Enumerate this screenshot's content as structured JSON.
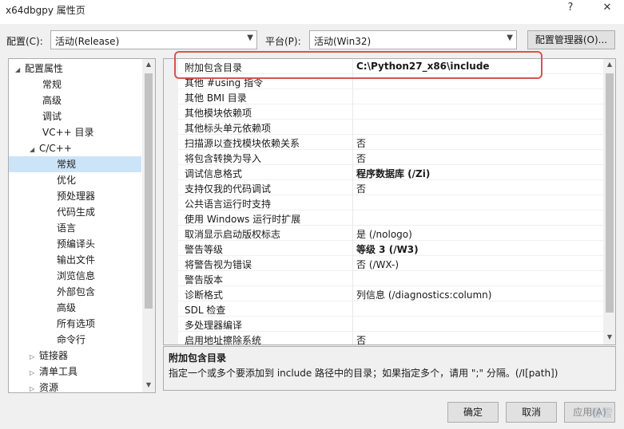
{
  "window": {
    "title": "x64dbgpy 属性页",
    "help_label": "?",
    "close_label": "✕"
  },
  "config_row": {
    "config_label": "配置(C):",
    "config_value": "活动(Release)",
    "platform_label": "平台(P):",
    "platform_value": "活动(Win32)",
    "manager_button": "配置管理器(O)..."
  },
  "tree": {
    "items": [
      {
        "label": "配置属性",
        "expander": "◢"
      },
      {
        "label": "常规"
      },
      {
        "label": "高级"
      },
      {
        "label": "调试"
      },
      {
        "label": "VC++ 目录"
      },
      {
        "label": "C/C++",
        "expander": "◢"
      },
      {
        "label": "常规",
        "selected": true
      },
      {
        "label": "优化"
      },
      {
        "label": "预处理器"
      },
      {
        "label": "代码生成"
      },
      {
        "label": "语言"
      },
      {
        "label": "预编译头"
      },
      {
        "label": "输出文件"
      },
      {
        "label": "浏览信息"
      },
      {
        "label": "外部包含"
      },
      {
        "label": "高级"
      },
      {
        "label": "所有选项"
      },
      {
        "label": "命令行"
      },
      {
        "label": "链接器",
        "expander": "▷"
      },
      {
        "label": "清单工具",
        "expander": "▷"
      },
      {
        "label": "资源",
        "expander": "▷"
      }
    ]
  },
  "properties": [
    {
      "name": "附加包含目录",
      "value": "C:\\Python27_x86\\include",
      "bold": true
    },
    {
      "name": "其他 #using 指令",
      "value": ""
    },
    {
      "name": "其他 BMI 目录",
      "value": ""
    },
    {
      "name": "其他模块依赖项",
      "value": ""
    },
    {
      "name": "其他标头单元依赖项",
      "value": ""
    },
    {
      "name": "扫描源以查找模块依赖关系",
      "value": "否"
    },
    {
      "name": "将包含转换为导入",
      "value": "否"
    },
    {
      "name": "调试信息格式",
      "value": "程序数据库 (/Zi)",
      "bold": true
    },
    {
      "name": "支持仅我的代码调试",
      "value": "否"
    },
    {
      "name": "公共语言运行时支持",
      "value": ""
    },
    {
      "name": "使用 Windows 运行时扩展",
      "value": ""
    },
    {
      "name": "取消显示启动版权标志",
      "value": "是 (/nologo)"
    },
    {
      "name": "警告等级",
      "value": "等级 3 (/W3)",
      "bold": true
    },
    {
      "name": "将警告视为错误",
      "value": "否 (/WX-)"
    },
    {
      "name": "警告版本",
      "value": ""
    },
    {
      "name": "诊断格式",
      "value": "列信息 (/diagnostics:column)"
    },
    {
      "name": "SDL 检查",
      "value": ""
    },
    {
      "name": "多处理器编译",
      "value": ""
    },
    {
      "name": "启用地址擦除系统",
      "value": "否"
    }
  ],
  "description": {
    "title": "附加包含目录",
    "text": "指定一个或多个要添加到 include 路径中的目录；如果指定多个，请用 \";\" 分隔。(/I[path])"
  },
  "buttons": {
    "ok": "确定",
    "cancel": "取消",
    "apply": "应用(A)"
  },
  "watermark": "看雪",
  "colors": {
    "highlight": "#d9534f",
    "selection": "#cce4f7"
  }
}
